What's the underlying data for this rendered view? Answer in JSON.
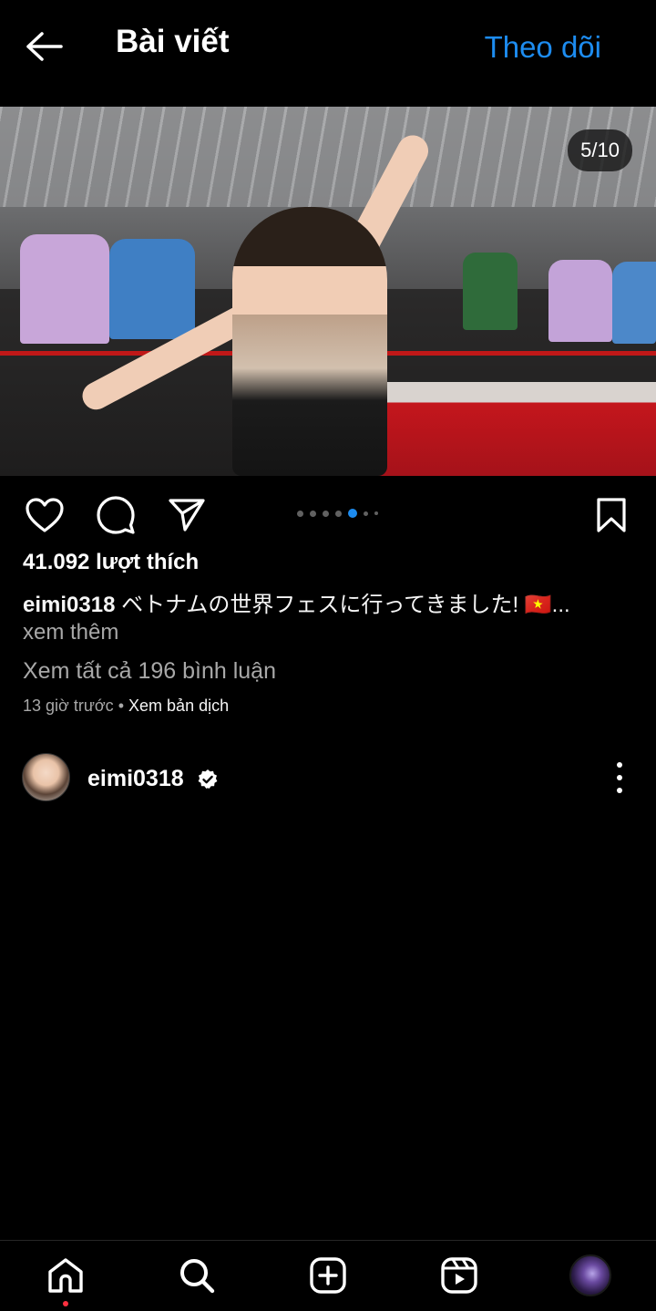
{
  "header": {
    "back_icon": "arrow-left-icon",
    "title": "Bài viết",
    "follow_label": "Theo dõi"
  },
  "post": {
    "image_counter": "5/10",
    "carousel": {
      "total": 10,
      "visible_dots": 7,
      "active_index": 5
    },
    "likes": "41.092 lượt thích",
    "caption_user": "eimi0318",
    "caption_text": "ベトナムの世界フェスに行ってきました! 🇻🇳...",
    "see_more": "xem thêm",
    "view_comments": "Xem tất cả 196 bình luận",
    "time_ago": "13 giờ trước",
    "separator": "•",
    "translate": "Xem bản dịch"
  },
  "actions": {
    "like_icon": "heart-icon",
    "comment_icon": "comment-bubble-icon",
    "share_icon": "paper-plane-icon",
    "save_icon": "bookmark-icon"
  },
  "author": {
    "username": "eimi0318",
    "verified": true,
    "more_icon": "more-vertical-icon"
  },
  "nav": {
    "items": [
      "home-icon",
      "search-icon",
      "create-post-icon",
      "reels-icon",
      "profile-avatar"
    ],
    "home_notification": true
  },
  "colors": {
    "background": "#000000",
    "accent": "#1d8cf0",
    "secondary_text": "#a8a8a8",
    "notification": "#ff3040"
  }
}
